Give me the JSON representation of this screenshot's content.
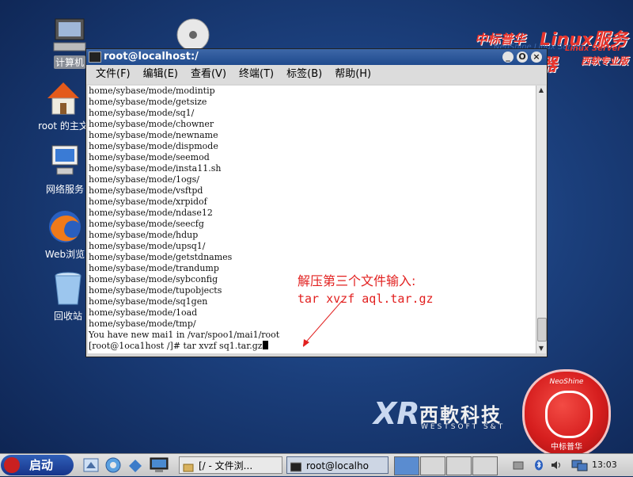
{
  "desktop": {
    "icons": [
      {
        "label": "计算机"
      },
      {
        "label": ""
      },
      {
        "label": "root 的主文"
      },
      {
        "label": "网络服务"
      },
      {
        "label": "Web浏览"
      },
      {
        "label": "回收站"
      }
    ]
  },
  "brand": {
    "cn": "中标普华",
    "linux": "Linux服务器",
    "server": "Linux Server",
    "edition": "西软专业版",
    "ghost": "NeoShine Linux Server"
  },
  "window": {
    "title": "root@localhost:/",
    "menu": [
      "文件(F)",
      "编辑(E)",
      "查看(V)",
      "终端(T)",
      "标签(B)",
      "帮助(H)"
    ],
    "buttons": [
      "_",
      "O",
      "×"
    ]
  },
  "terminal": {
    "lines": [
      "home/sybase/mode/modintip",
      "home/sybase/mode/getsize",
      "home/sybase/mode/sq1/",
      "home/sybase/mode/chowner",
      "home/sybase/mode/newname",
      "home/sybase/mode/dispmode",
      "home/sybase/mode/seemod",
      "home/sybase/mode/insta11.sh",
      "home/sybase/mode/1ogs/",
      "home/sybase/mode/vsftpd",
      "home/sybase/mode/xrpidof",
      "home/sybase/mode/ndase12",
      "home/sybase/mode/seecfg",
      "home/sybase/mode/hdup",
      "home/sybase/mode/upsq1/",
      "home/sybase/mode/getstdnames",
      "home/sybase/mode/trandump",
      "home/sybase/mode/sybconfig",
      "home/sybase/mode/tupobjects",
      "home/sybase/mode/sq1gen",
      "home/sybase/mode/1oad",
      "home/sybase/mode/tmp/",
      "You have new mai1 in /var/spoo1/mai1/root"
    ],
    "prompt": "[root@1oca1host /]# tar xvzf sq1.tar.gz"
  },
  "annotation": {
    "line1": "解压第三个文件输入:",
    "line2": "tar xvzf aql.tar.gz"
  },
  "logos": {
    "xr": "XR",
    "xr_cn": "西軟科技",
    "xr_en": "WESTSOFT S&T",
    "neo_top": "NeoShine",
    "neo_bottom": "中标普华"
  },
  "taskbar": {
    "start": "启动",
    "tasks": [
      "[/ - 文件浏...",
      "root@localho"
    ],
    "clock": "13:03"
  },
  "colors": {
    "annotation": "#e2201f",
    "titlebar": "#2a5596",
    "desktop": "#1b3f7c"
  }
}
